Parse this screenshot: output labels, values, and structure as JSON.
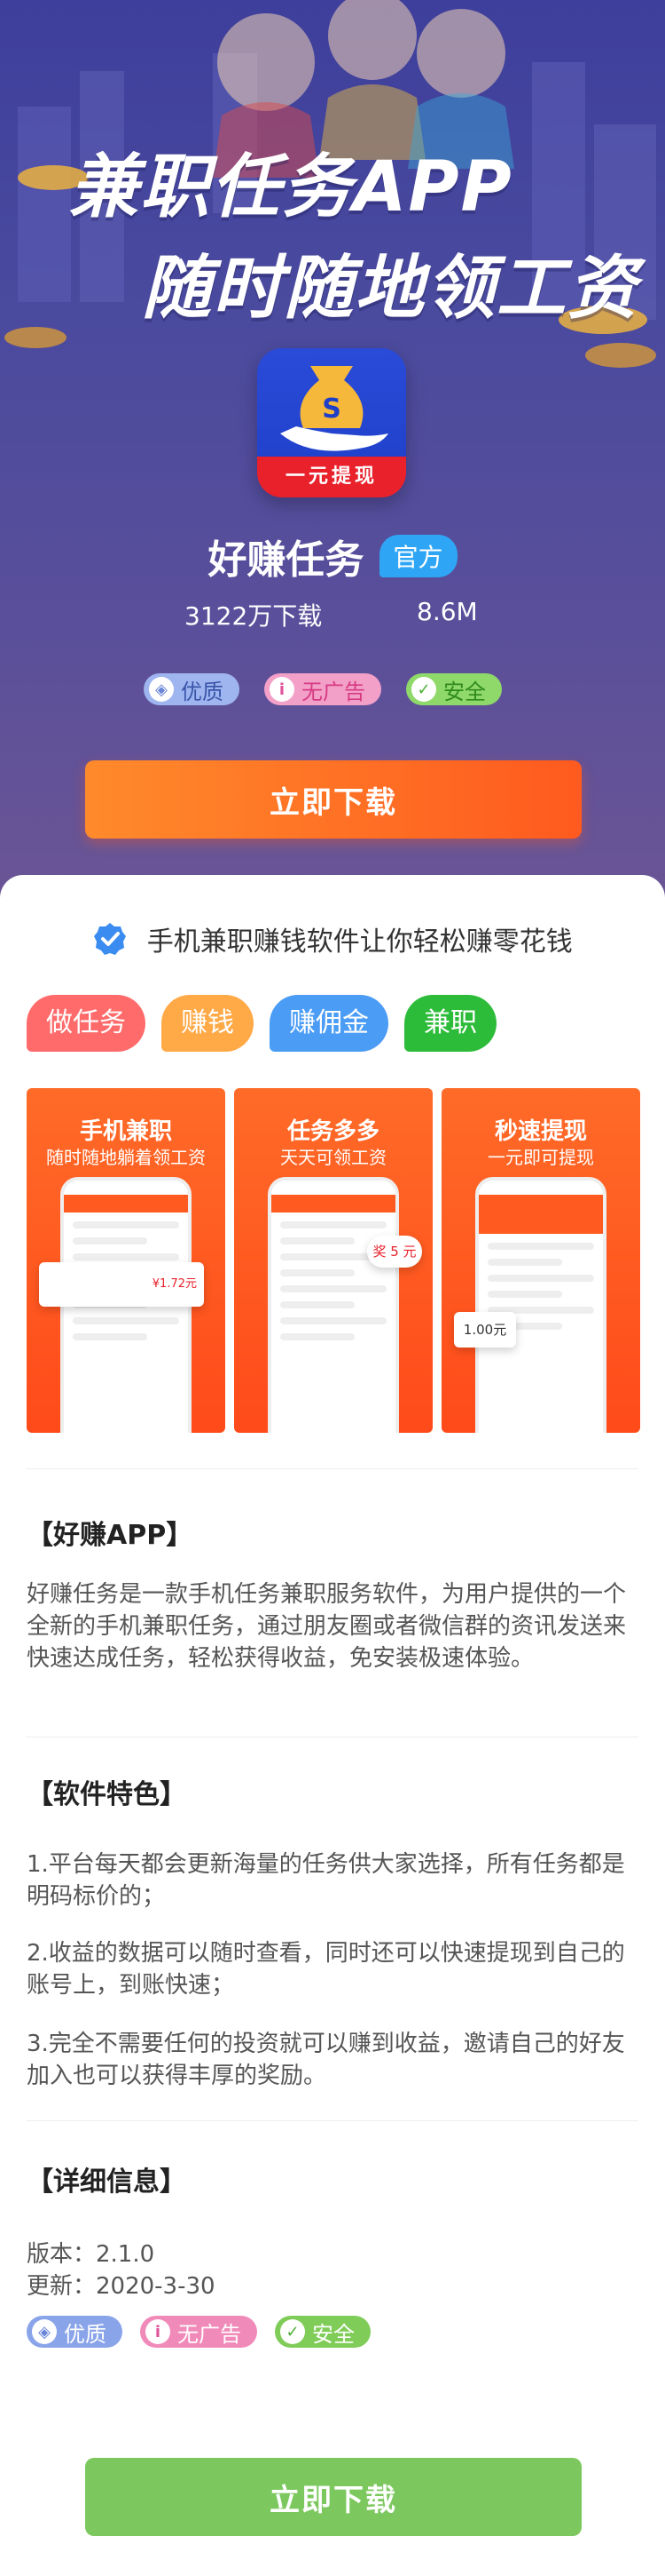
{
  "hero": {
    "headline_line1": "兼职任务APP",
    "headline_line2": "随时随地领工资",
    "app_icon_ribbon": "一元提现",
    "app_name": "好赚任务",
    "official_badge": "官方",
    "downloads": "3122万下载",
    "size": "8.6M",
    "tags": [
      "优质",
      "无广告",
      "安全"
    ],
    "download_button": "立即下载"
  },
  "slogan": "手机兼职赚钱软件让你轻松赚零花钱",
  "category_tags": [
    "做任务",
    "赚钱",
    "赚佣金",
    "兼职"
  ],
  "screenshots": [
    {
      "title": "手机兼职",
      "subtitle": "随时随地躺着领工资",
      "badge": "¥1.72元"
    },
    {
      "title": "任务多多",
      "subtitle": "天天可领工资",
      "badge": "奖 5 元"
    },
    {
      "title": "秒速提现",
      "subtitle": "一元即可提现",
      "badge": "1.00元"
    }
  ],
  "about": {
    "title": "【好赚APP】",
    "text": "好赚任务是一款手机任务兼职服务软件，为用户提供的一个全新的手机兼职任务，通过朋友圈或者微信群的资讯发送来快速达成任务，轻松获得收益，免安装极速体验。"
  },
  "features": {
    "title": "【软件特色】",
    "items": [
      "1.平台每天都会更新海量的任务供大家选择，所有任务都是明码标价的；",
      "2.收益的数据可以随时查看，同时还可以快速提现到自己的账号上，到账快速；",
      "3.完全不需要任何的投资就可以赚到收益，邀请自己的好友加入也可以获得丰厚的奖励。"
    ]
  },
  "details": {
    "title": "【详细信息】",
    "version": "版本：2.1.0",
    "updated": "更新：2020-3-30",
    "tags": [
      "优质",
      "无广告",
      "安全"
    ]
  },
  "bottom_download_button": "立即下载",
  "colors": {
    "hero_bg": "#4a4a9e",
    "download_orange": "#ff5a1f",
    "bottom_download_green": "#7cc85e",
    "official_blue": "#2fa6f5"
  }
}
